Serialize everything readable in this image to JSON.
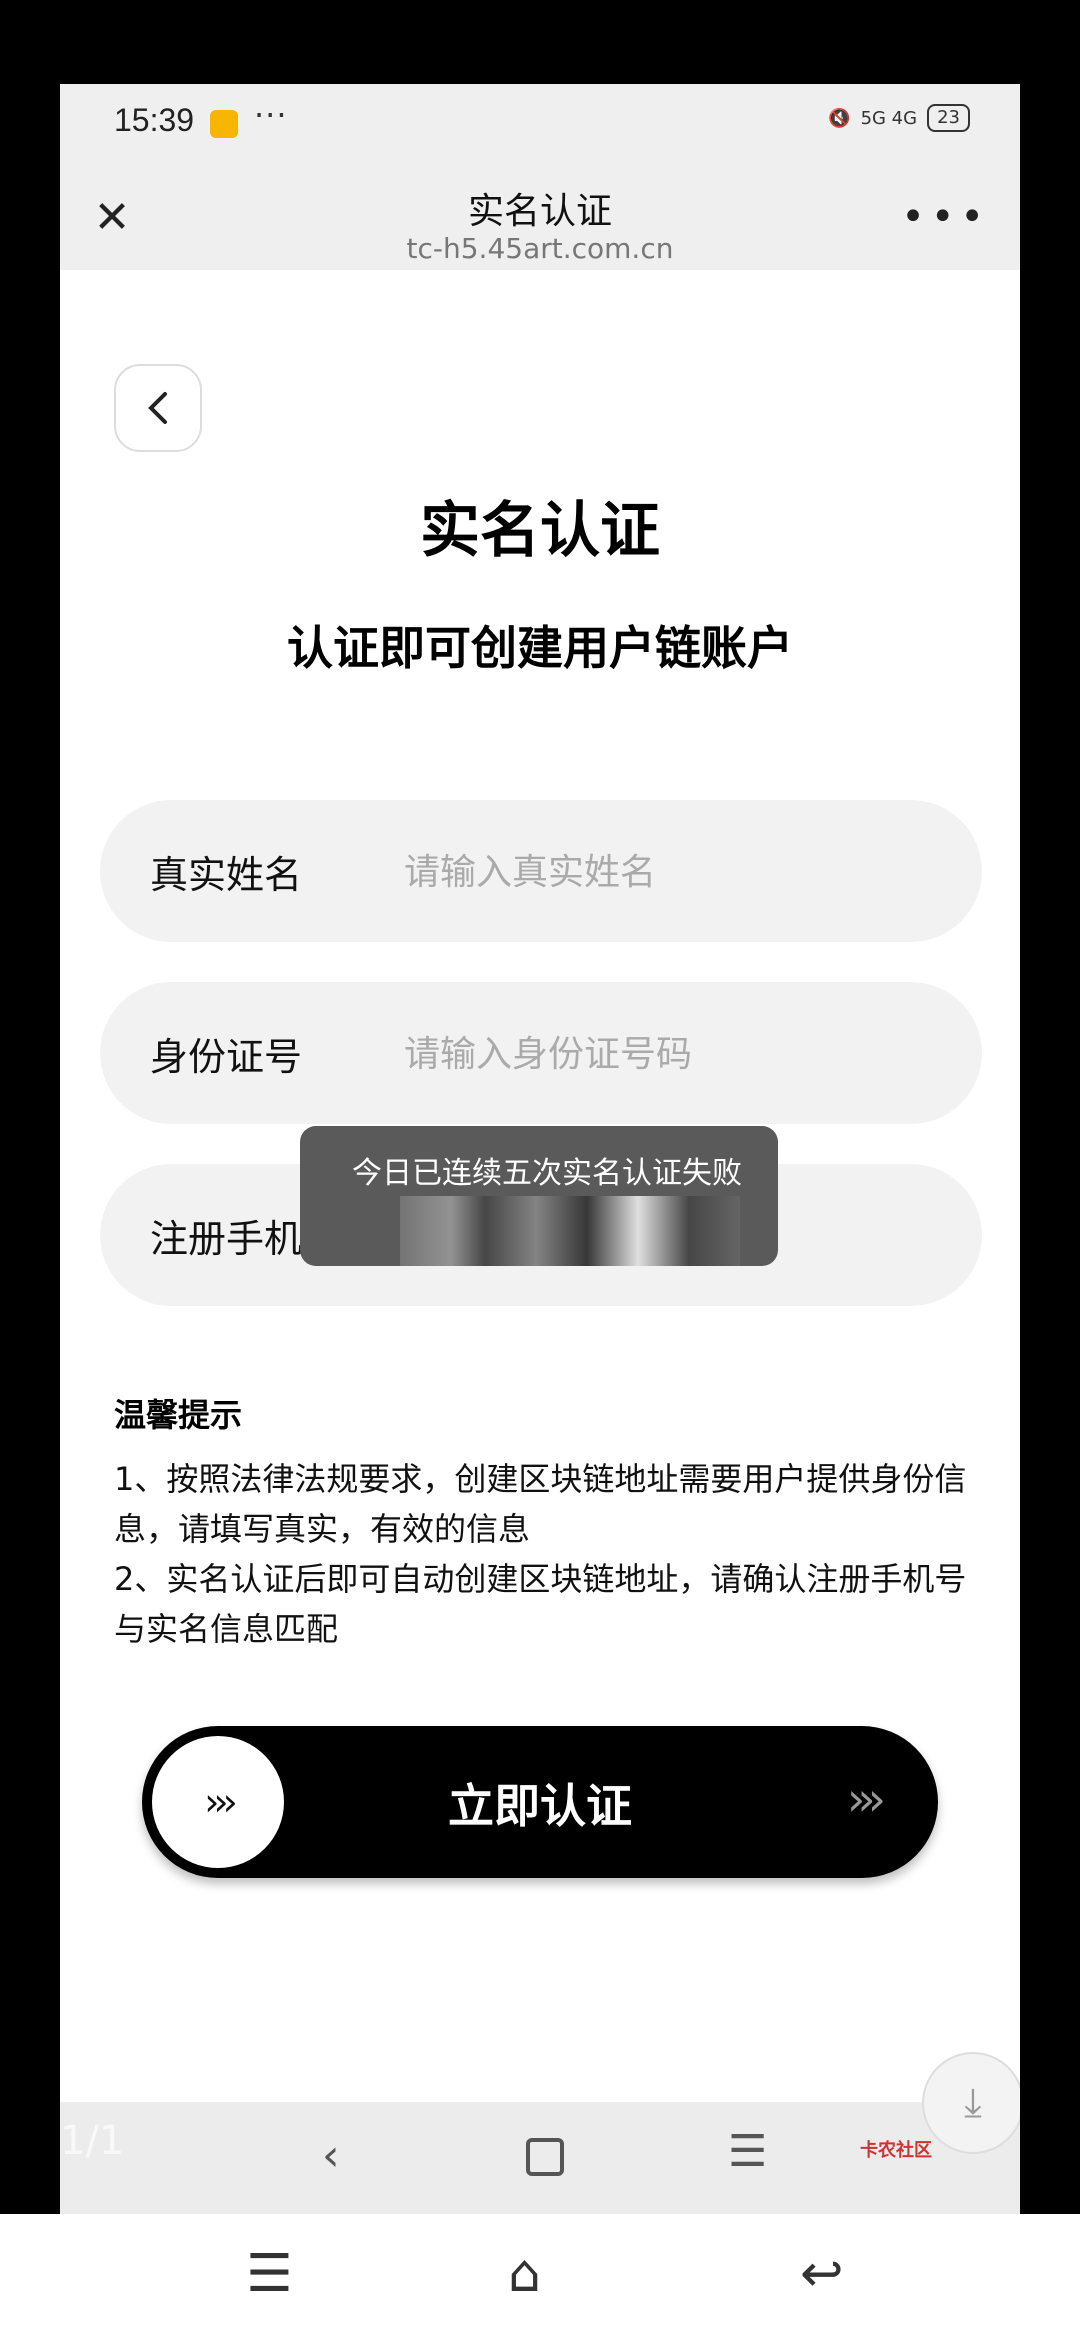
{
  "status_bar": {
    "time": "15:39",
    "more": "···",
    "signal": "5G 4G",
    "battery": "23"
  },
  "browser": {
    "title": "实名认证",
    "url": "tc-h5.45art.com.cn",
    "close_icon": "close-icon",
    "more_icon": "more-horizontal-icon"
  },
  "page": {
    "title": "实名认证",
    "subtitle": "认证即可创建用户链账户"
  },
  "form": {
    "name_label": "真实姓名",
    "name_placeholder": "请输入真实姓名",
    "id_label": "身份证号",
    "id_placeholder": "请输入身份证号码",
    "phone_label": "注册手机"
  },
  "toast": {
    "text": "今日已连续五次实名认证失败"
  },
  "tips": {
    "title": "温馨提示",
    "items": [
      "1、按照法律法规要求，创建区块链地址需要用户提供身份信息，请填写真实，有效的信息",
      "2、实名认证后即可自动创建区块链地址，请确认注册手机号与实名信息匹配"
    ]
  },
  "cta": {
    "label": "立即认证",
    "knob_arrows": "›››",
    "arrows": "›››"
  },
  "bottom_nav": {
    "page_indicator": "1/1",
    "watermark": "卡农社区"
  },
  "colors": {
    "accent": "#000000",
    "field_bg": "#f2f2f2",
    "placeholder": "#aaaaaa"
  }
}
